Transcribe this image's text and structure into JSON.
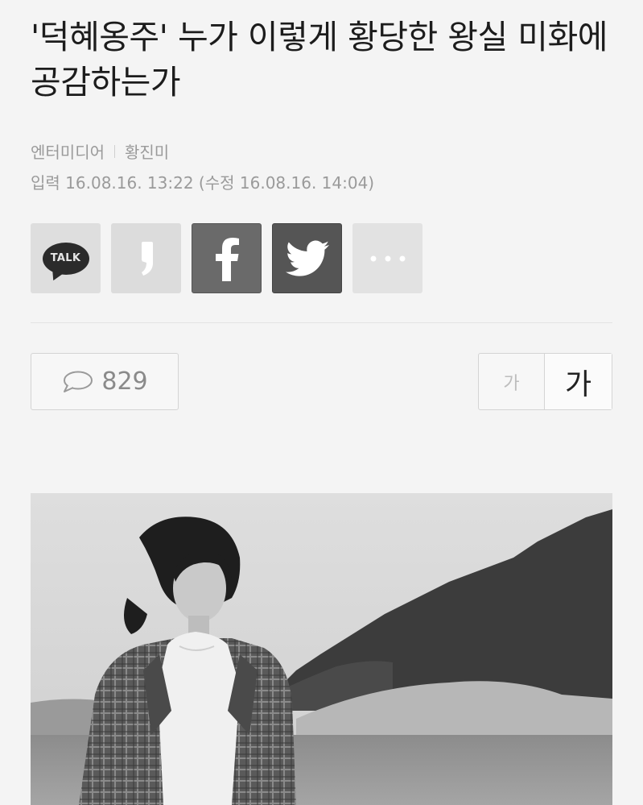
{
  "article": {
    "title": "'덕혜옹주' 누가 이렇게 황당한 왕실 미화에 공감하는가",
    "source": "엔터미디어",
    "author": "황진미",
    "dates": "입력 16.08.16. 13:22 (수정 16.08.16. 14:04)"
  },
  "share": {
    "kakao_label": "TALK"
  },
  "comments": {
    "count": "829"
  },
  "font_size": {
    "small_label": "가",
    "large_label": "가"
  },
  "photo": {
    "icon": "photo-icon"
  },
  "colors": {
    "background": "#f4f4f4",
    "facebook_button": "#6a6a6a",
    "twitter_button": "#555555"
  }
}
